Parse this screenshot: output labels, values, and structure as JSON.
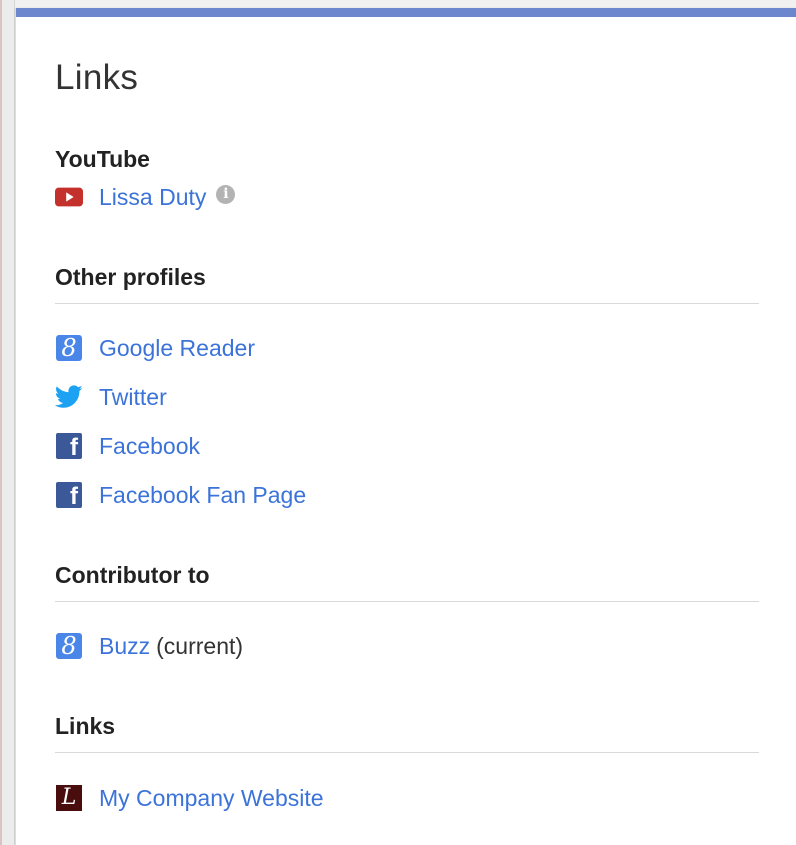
{
  "card": {
    "title": "Links"
  },
  "youtube": {
    "heading": "YouTube",
    "icon": "youtube-icon",
    "link_label": "Lissa Duty",
    "info_icon": "info-icon",
    "info_glyph": "i"
  },
  "other_profiles": {
    "heading": "Other profiles",
    "items": [
      {
        "label": "Google Reader",
        "icon": "google-icon",
        "glyph": "8"
      },
      {
        "label": "Twitter",
        "icon": "twitter-icon"
      },
      {
        "label": "Facebook",
        "icon": "facebook-icon",
        "glyph": "f"
      },
      {
        "label": "Facebook Fan Page",
        "icon": "facebook-icon",
        "glyph": "f"
      }
    ]
  },
  "contributor": {
    "heading": "Contributor to",
    "items": [
      {
        "label": "Buzz",
        "suffix": "(current)",
        "icon": "google-icon",
        "glyph": "8"
      }
    ]
  },
  "links": {
    "heading": "Links",
    "items": [
      {
        "label": "My Company Website",
        "icon": "company-favicon-icon",
        "glyph": "L"
      }
    ]
  },
  "colors": {
    "accent_bar": "#6d87cf",
    "link": "#3b73d9",
    "google_blue": "#4a86e8",
    "facebook_blue": "#3b5998",
    "twitter_blue": "#1da1f2",
    "youtube_red": "#c4302b"
  }
}
